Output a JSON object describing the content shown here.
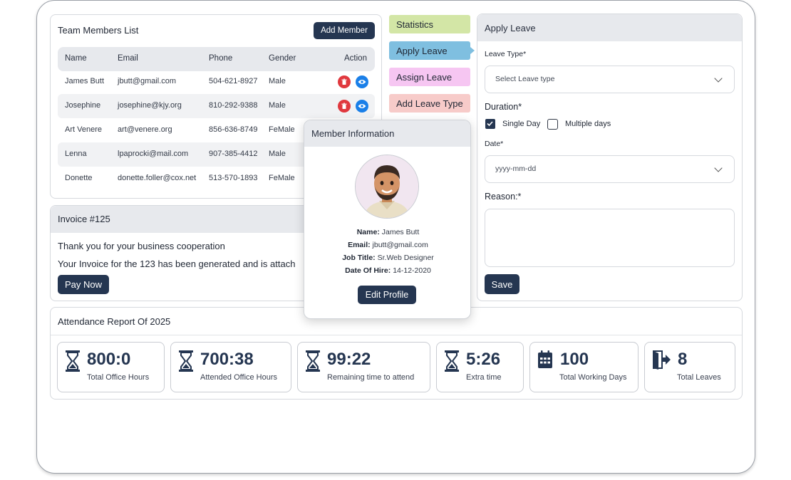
{
  "team": {
    "title": "Team Members List",
    "add_button": "Add Member",
    "headers": {
      "name": "Name",
      "email": "Email",
      "phone": "Phone",
      "gender": "Gender",
      "action": "Action"
    },
    "rows": [
      {
        "name": "James Butt",
        "email": "jbutt@gmail.com",
        "phone": "504-621-8927",
        "gender": "Male"
      },
      {
        "name": "Josephine",
        "email": "josephine@kjy.org",
        "phone": "810-292-9388",
        "gender": "Male"
      },
      {
        "name": "Art Venere",
        "email": "art@venere.org",
        "phone": "856-636-8749",
        "gender": "FeMale"
      },
      {
        "name": "Lenna",
        "email": "lpaprocki@mail.com",
        "phone": "907-385-4412",
        "gender": "Male"
      },
      {
        "name": "Donette",
        "email": "donette.foller@cox.net",
        "phone": "513-570-1893",
        "gender": "FeMale"
      }
    ]
  },
  "tabs": [
    {
      "label": "Statistics",
      "color": "#d3e6a6"
    },
    {
      "label": "Apply Leave",
      "color": "#7fbfe0"
    },
    {
      "label": "Assign Leave",
      "color": "#f6c6f2"
    },
    {
      "label": "Add Leave Type",
      "color": "#f7cbc9"
    }
  ],
  "invoice": {
    "title": "Invoice #125",
    "line1": "Thank you for your business cooperation",
    "line2": "Your Invoice for the 123 has been generated and is attach",
    "pay_button": "Pay Now"
  },
  "leave": {
    "title": "Apply Leave",
    "leave_type_label": "Leave Type*",
    "leave_type_placeholder": "Select Leave type",
    "duration_label": "Duration*",
    "single_day": "Single Day",
    "single_day_checked": true,
    "multiple_days": "Multiple days",
    "multiple_days_checked": false,
    "date_label": "Date*",
    "date_placeholder": "yyyy-mm-dd",
    "reason_label": "Reason:*",
    "save_button": "Save"
  },
  "member": {
    "title": "Member Information",
    "name_label": "Name:",
    "name": "James Butt",
    "email_label": "Email:",
    "email": "jbutt@gmail.com",
    "job_label": "Job Title:",
    "job": "Sr.Web Designer",
    "hire_label": "Date Of Hire:",
    "hire": "14-12-2020",
    "edit_button": "Edit Profile"
  },
  "attendance": {
    "title": "Attendance Report Of 2025",
    "stats": [
      {
        "value": "800:0",
        "label": "Total Office Hours",
        "icon": "hourglass-icon"
      },
      {
        "value": "700:38",
        "label": "Attended Office Hours",
        "icon": "hourglass-icon"
      },
      {
        "value": "99:22",
        "label": "Remaining time to attend",
        "icon": "hourglass-icon"
      },
      {
        "value": "5:26",
        "label": "Extra time",
        "icon": "hourglass-icon"
      },
      {
        "value": "100",
        "label": "Total Working Days",
        "icon": "calendar-icon"
      },
      {
        "value": "8",
        "label": "Total Leaves",
        "icon": "exit-door-icon"
      }
    ]
  },
  "colors": {
    "primary": "#253651",
    "delete": "#e0383e",
    "view": "#1a7fe8"
  }
}
